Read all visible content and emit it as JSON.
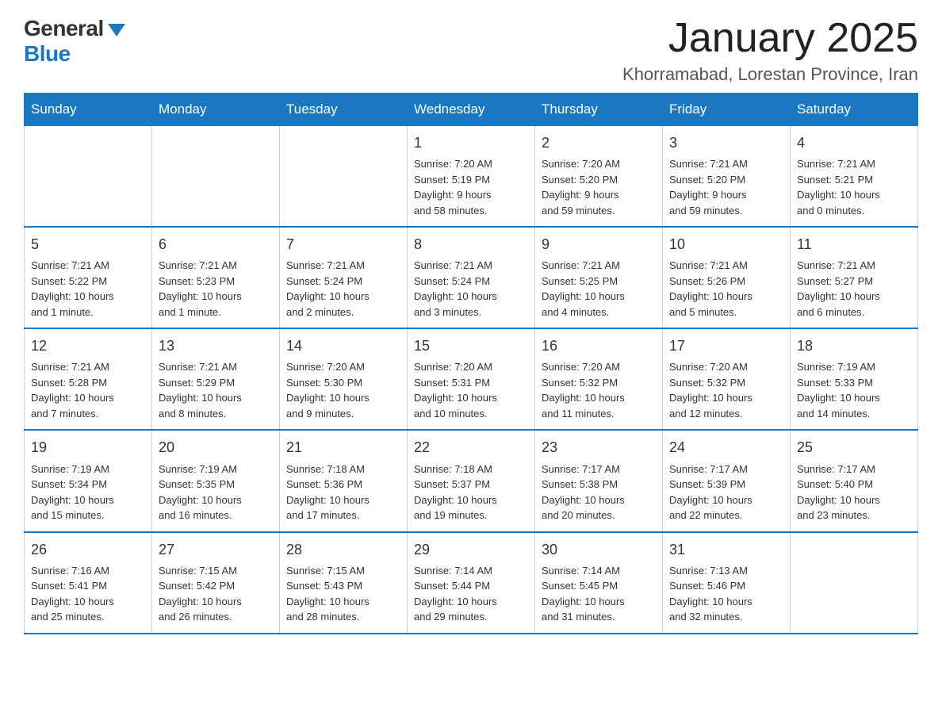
{
  "header": {
    "logo_general": "General",
    "logo_blue": "Blue",
    "month_title": "January 2025",
    "location": "Khorramabad, Lorestan Province, Iran"
  },
  "weekdays": [
    "Sunday",
    "Monday",
    "Tuesday",
    "Wednesday",
    "Thursday",
    "Friday",
    "Saturday"
  ],
  "weeks": [
    [
      {
        "day": "",
        "info": ""
      },
      {
        "day": "",
        "info": ""
      },
      {
        "day": "",
        "info": ""
      },
      {
        "day": "1",
        "info": "Sunrise: 7:20 AM\nSunset: 5:19 PM\nDaylight: 9 hours\nand 58 minutes."
      },
      {
        "day": "2",
        "info": "Sunrise: 7:20 AM\nSunset: 5:20 PM\nDaylight: 9 hours\nand 59 minutes."
      },
      {
        "day": "3",
        "info": "Sunrise: 7:21 AM\nSunset: 5:20 PM\nDaylight: 9 hours\nand 59 minutes."
      },
      {
        "day": "4",
        "info": "Sunrise: 7:21 AM\nSunset: 5:21 PM\nDaylight: 10 hours\nand 0 minutes."
      }
    ],
    [
      {
        "day": "5",
        "info": "Sunrise: 7:21 AM\nSunset: 5:22 PM\nDaylight: 10 hours\nand 1 minute."
      },
      {
        "day": "6",
        "info": "Sunrise: 7:21 AM\nSunset: 5:23 PM\nDaylight: 10 hours\nand 1 minute."
      },
      {
        "day": "7",
        "info": "Sunrise: 7:21 AM\nSunset: 5:24 PM\nDaylight: 10 hours\nand 2 minutes."
      },
      {
        "day": "8",
        "info": "Sunrise: 7:21 AM\nSunset: 5:24 PM\nDaylight: 10 hours\nand 3 minutes."
      },
      {
        "day": "9",
        "info": "Sunrise: 7:21 AM\nSunset: 5:25 PM\nDaylight: 10 hours\nand 4 minutes."
      },
      {
        "day": "10",
        "info": "Sunrise: 7:21 AM\nSunset: 5:26 PM\nDaylight: 10 hours\nand 5 minutes."
      },
      {
        "day": "11",
        "info": "Sunrise: 7:21 AM\nSunset: 5:27 PM\nDaylight: 10 hours\nand 6 minutes."
      }
    ],
    [
      {
        "day": "12",
        "info": "Sunrise: 7:21 AM\nSunset: 5:28 PM\nDaylight: 10 hours\nand 7 minutes."
      },
      {
        "day": "13",
        "info": "Sunrise: 7:21 AM\nSunset: 5:29 PM\nDaylight: 10 hours\nand 8 minutes."
      },
      {
        "day": "14",
        "info": "Sunrise: 7:20 AM\nSunset: 5:30 PM\nDaylight: 10 hours\nand 9 minutes."
      },
      {
        "day": "15",
        "info": "Sunrise: 7:20 AM\nSunset: 5:31 PM\nDaylight: 10 hours\nand 10 minutes."
      },
      {
        "day": "16",
        "info": "Sunrise: 7:20 AM\nSunset: 5:32 PM\nDaylight: 10 hours\nand 11 minutes."
      },
      {
        "day": "17",
        "info": "Sunrise: 7:20 AM\nSunset: 5:32 PM\nDaylight: 10 hours\nand 12 minutes."
      },
      {
        "day": "18",
        "info": "Sunrise: 7:19 AM\nSunset: 5:33 PM\nDaylight: 10 hours\nand 14 minutes."
      }
    ],
    [
      {
        "day": "19",
        "info": "Sunrise: 7:19 AM\nSunset: 5:34 PM\nDaylight: 10 hours\nand 15 minutes."
      },
      {
        "day": "20",
        "info": "Sunrise: 7:19 AM\nSunset: 5:35 PM\nDaylight: 10 hours\nand 16 minutes."
      },
      {
        "day": "21",
        "info": "Sunrise: 7:18 AM\nSunset: 5:36 PM\nDaylight: 10 hours\nand 17 minutes."
      },
      {
        "day": "22",
        "info": "Sunrise: 7:18 AM\nSunset: 5:37 PM\nDaylight: 10 hours\nand 19 minutes."
      },
      {
        "day": "23",
        "info": "Sunrise: 7:17 AM\nSunset: 5:38 PM\nDaylight: 10 hours\nand 20 minutes."
      },
      {
        "day": "24",
        "info": "Sunrise: 7:17 AM\nSunset: 5:39 PM\nDaylight: 10 hours\nand 22 minutes."
      },
      {
        "day": "25",
        "info": "Sunrise: 7:17 AM\nSunset: 5:40 PM\nDaylight: 10 hours\nand 23 minutes."
      }
    ],
    [
      {
        "day": "26",
        "info": "Sunrise: 7:16 AM\nSunset: 5:41 PM\nDaylight: 10 hours\nand 25 minutes."
      },
      {
        "day": "27",
        "info": "Sunrise: 7:15 AM\nSunset: 5:42 PM\nDaylight: 10 hours\nand 26 minutes."
      },
      {
        "day": "28",
        "info": "Sunrise: 7:15 AM\nSunset: 5:43 PM\nDaylight: 10 hours\nand 28 minutes."
      },
      {
        "day": "29",
        "info": "Sunrise: 7:14 AM\nSunset: 5:44 PM\nDaylight: 10 hours\nand 29 minutes."
      },
      {
        "day": "30",
        "info": "Sunrise: 7:14 AM\nSunset: 5:45 PM\nDaylight: 10 hours\nand 31 minutes."
      },
      {
        "day": "31",
        "info": "Sunrise: 7:13 AM\nSunset: 5:46 PM\nDaylight: 10 hours\nand 32 minutes."
      },
      {
        "day": "",
        "info": ""
      }
    ]
  ]
}
